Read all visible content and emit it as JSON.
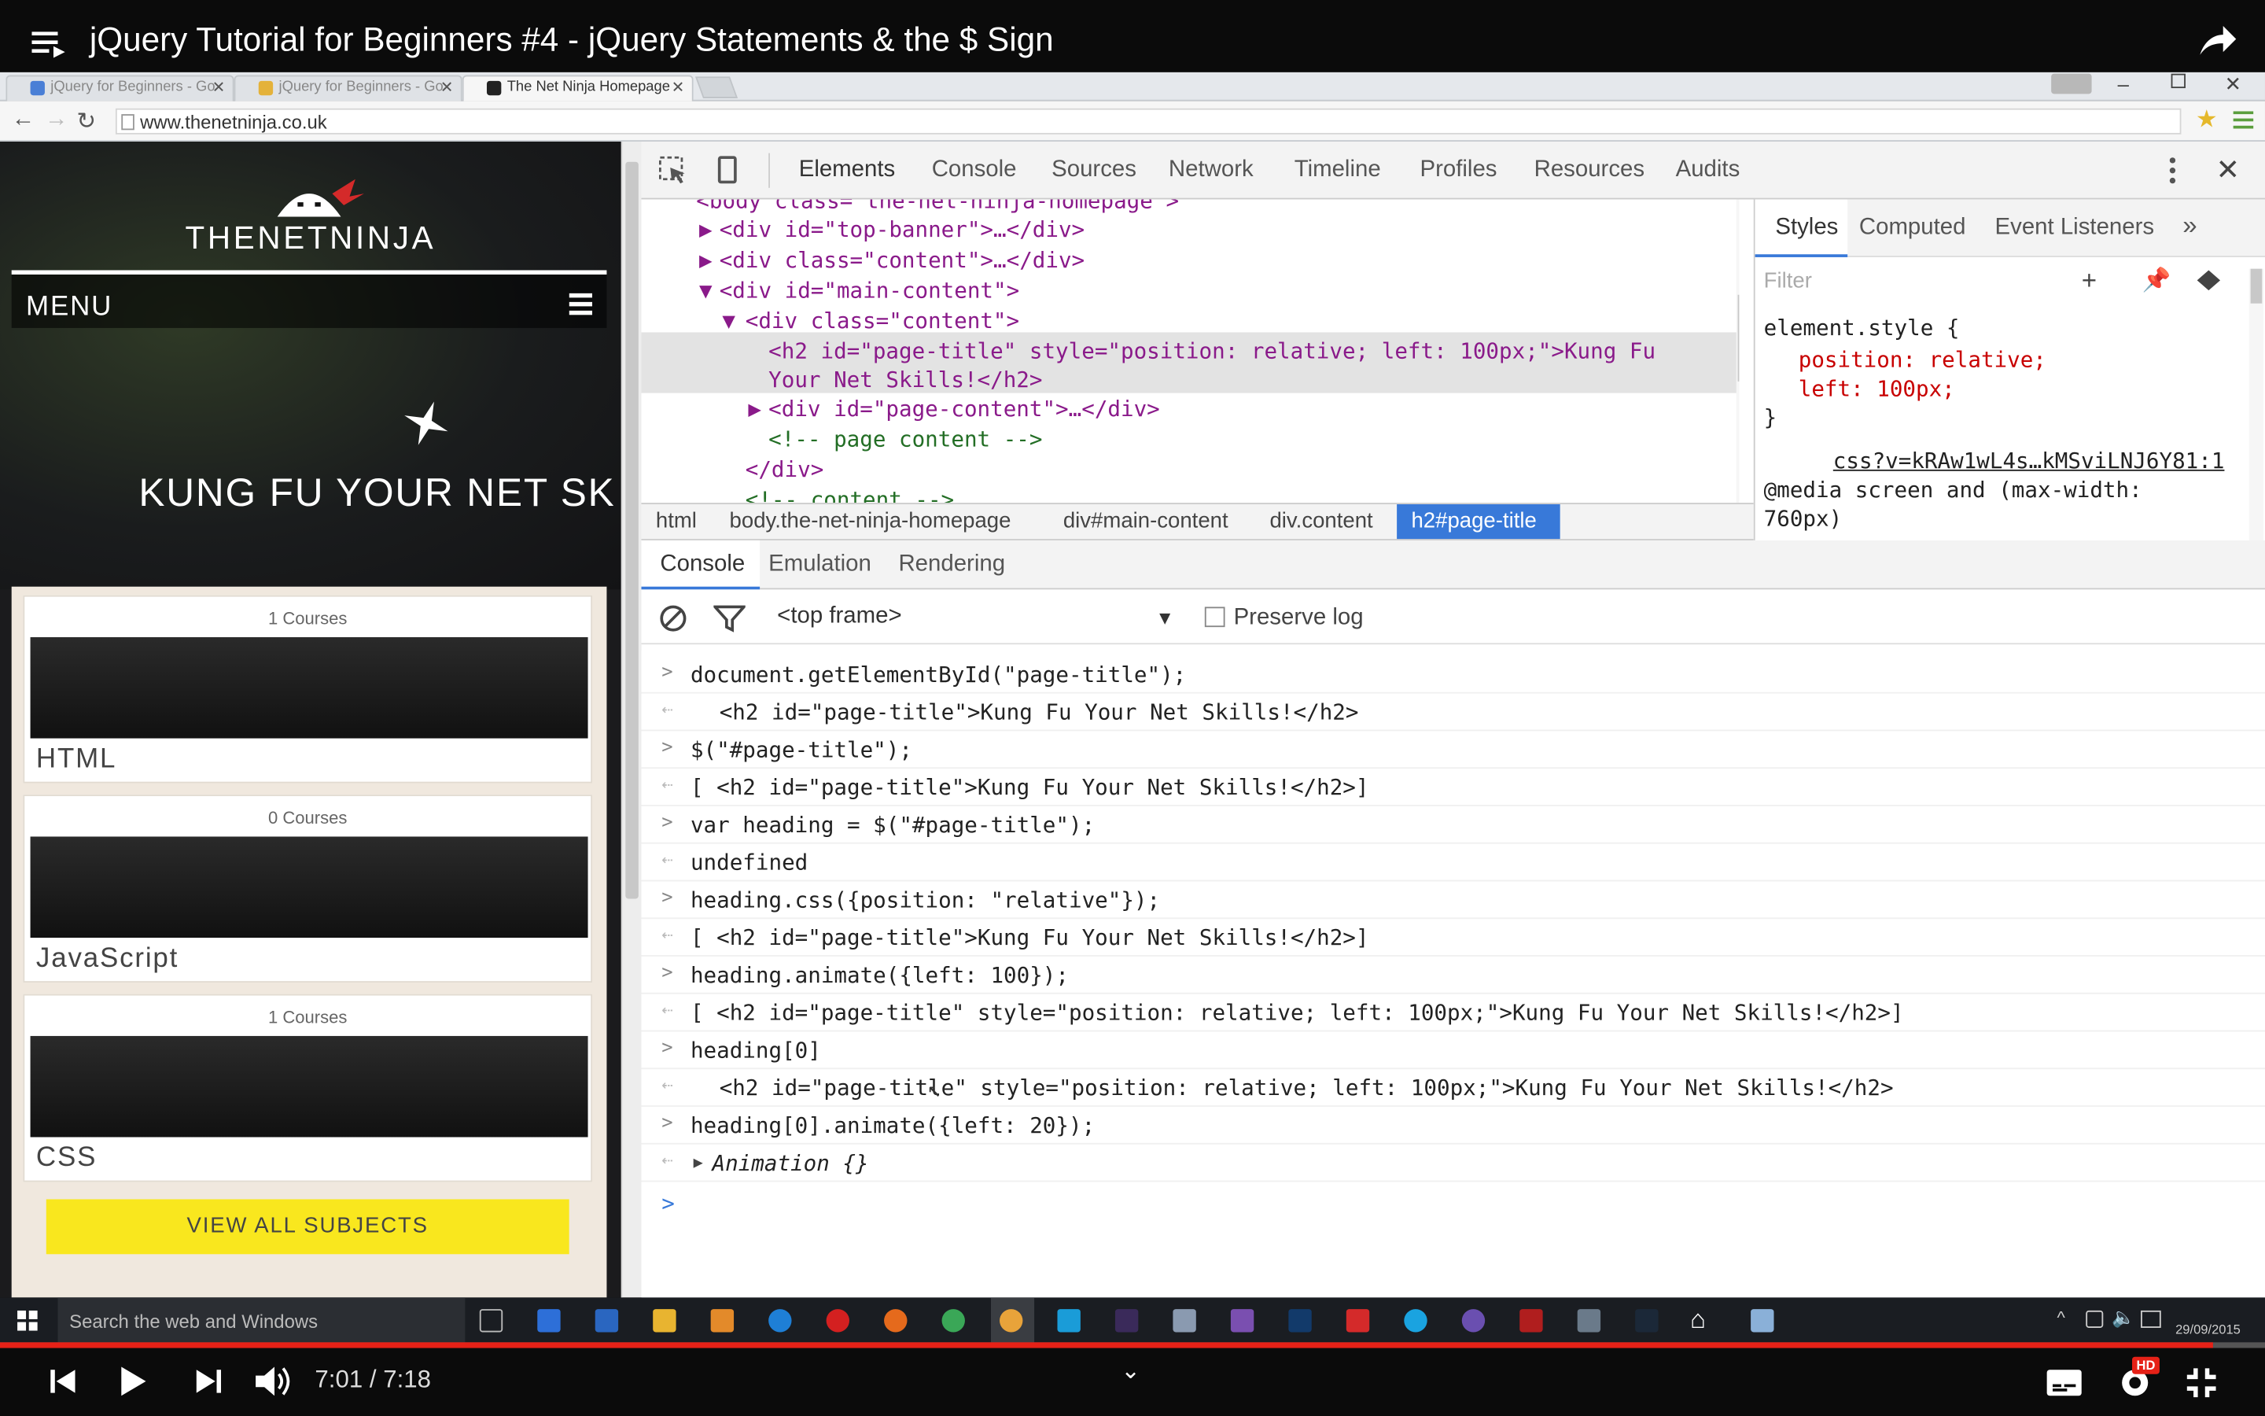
{
  "video": {
    "title": "jQuery Tutorial for Beginners #4 - jQuery Statements & the $ Sign",
    "time": "7:01 / 7:18",
    "progress_fraction": 0.9768,
    "hd_badge": "HD"
  },
  "browser": {
    "tabs": [
      {
        "label": "jQuery for Beginners - Go"
      },
      {
        "label": "jQuery for Beginners - Go"
      },
      {
        "label": "The Net Ninja Homepage"
      }
    ],
    "url": "www.thenetninja.co.uk"
  },
  "site": {
    "logo": "THENETNINJA",
    "menu_label": "MENU",
    "hero_heading": "KUNG FU YOUR NET SK",
    "cards": [
      {
        "count": "1 Courses",
        "name": "HTML"
      },
      {
        "count": "0 Courses",
        "name": "JavaScript"
      },
      {
        "count": "1 Courses",
        "name": "CSS"
      }
    ],
    "view_all": "VIEW ALL SUBJECTS"
  },
  "devtools": {
    "tabs": [
      "Elements",
      "Console",
      "Sources",
      "Network",
      "Timeline",
      "Profiles",
      "Resources",
      "Audits"
    ],
    "dom_lines": [
      "<body class=\"the-net-ninja-homepage\">",
      "<div id=\"top-banner\">…</div>",
      "<div class=\"content\">…</div>",
      "<div id=\"main-content\">",
      "<div class=\"content\">",
      "<h2 id=\"page-title\" style=\"position: relative; left: 100px;\">Kung Fu",
      "Your Net Skills!</h2>",
      "<div id=\"page-content\">…</div>",
      "<!-- page content -->",
      "</div>",
      "<!-- content -->"
    ],
    "breadcrumbs": [
      "html",
      "body.the-net-ninja-homepage",
      "div#main-content",
      "div.content",
      "h2#page-title"
    ],
    "styles_tabs": [
      "Styles",
      "Computed",
      "Event Listeners"
    ],
    "styles_filter_placeholder": "Filter",
    "styles_lines": [
      "element.style {",
      "position: relative;",
      "left: 100px;",
      "}",
      "css?v=kRAw1wL4s…kMSviLNJ6Y81:1",
      "@media screen and (max-width:",
      "760px)"
    ],
    "drawer_tabs": [
      "Console",
      "Emulation",
      "Rendering"
    ],
    "frame_select": "<top frame>",
    "preserve_log": "Preserve log",
    "console_lines": [
      {
        "type": "in",
        "text": "document.getElementById(\"page-title\");"
      },
      {
        "type": "out",
        "text": "<h2 id=\"page-title\">Kung Fu Your Net Skills!</h2>"
      },
      {
        "type": "in",
        "text": "$(\"#page-title\");"
      },
      {
        "type": "out",
        "text": "[ <h2 id=\"page-title\">Kung Fu Your Net Skills!</h2>]"
      },
      {
        "type": "in",
        "text": "var heading = $(\"#page-title\");"
      },
      {
        "type": "out",
        "text": "undefined"
      },
      {
        "type": "in",
        "text": "heading.css({position: \"relative\"});"
      },
      {
        "type": "out",
        "text": "[ <h2 id=\"page-title\">Kung Fu Your Net Skills!</h2>]"
      },
      {
        "type": "in",
        "text": "heading.animate({left: 100});"
      },
      {
        "type": "out",
        "text": "[ <h2 id=\"page-title\" style=\"position: relative; left: 100px;\">Kung Fu Your Net Skills!</h2>]"
      },
      {
        "type": "in",
        "text": "heading[0]"
      },
      {
        "type": "out",
        "text": "<h2 id=\"page-title\" style=\"position: relative; left: 100px;\">Kung Fu Your Net Skills!</h2>"
      },
      {
        "type": "in",
        "text": "heading[0].animate({left: 20});"
      },
      {
        "type": "out",
        "text": "Animation {}"
      }
    ]
  },
  "taskbar": {
    "search_placeholder": "Search the web and Windows",
    "clock_date": "29/09/2015"
  },
  "colors": {
    "devtools_accent": "#3879d9",
    "progress_red": "#e62117",
    "view_all_yellow": "#f9e71e"
  }
}
